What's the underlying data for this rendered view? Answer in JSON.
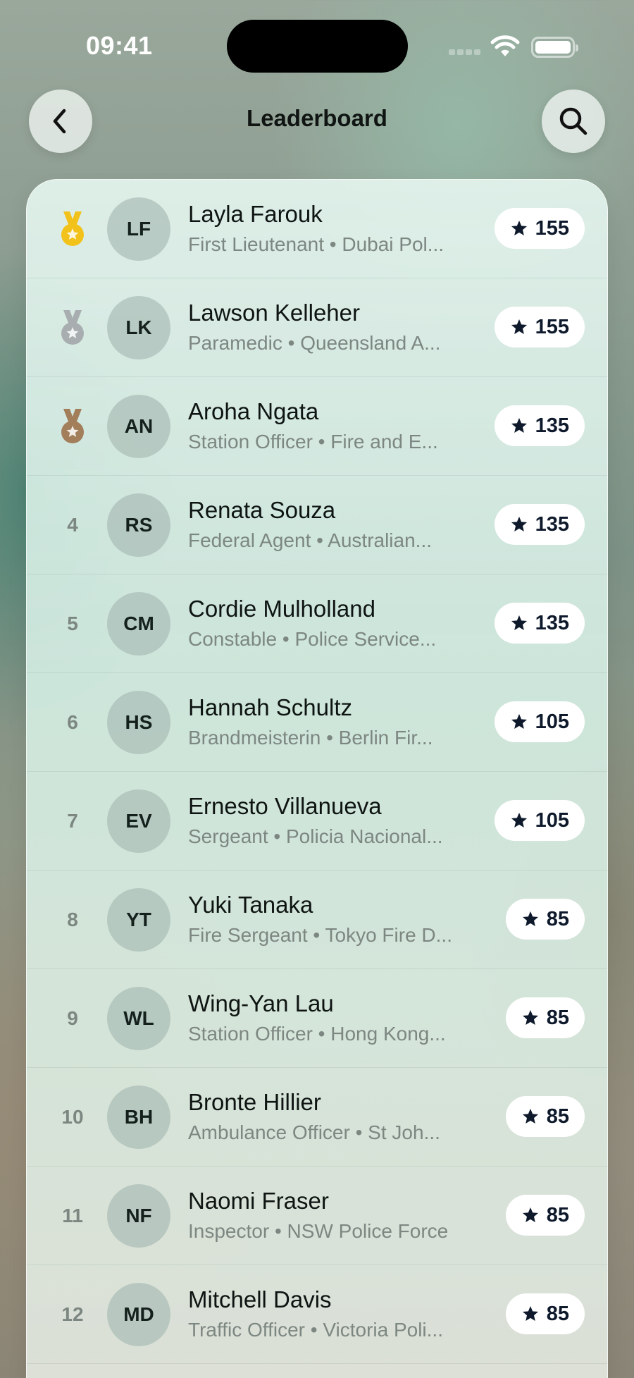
{
  "status_bar": {
    "time": "09:41"
  },
  "header": {
    "title": "Leaderboard",
    "back_icon": "chevron-left-icon",
    "search_icon": "search-icon"
  },
  "colors": {
    "gold": "#F2C21B",
    "silver": "#A8AEB0",
    "bronze": "#A37E5A",
    "score_text": "#0E1A2C"
  },
  "entries": [
    {
      "rank": "1",
      "medal": "gold",
      "initials": "LF",
      "name": "Layla Farouk",
      "subtitle": "First Lieutenant • Dubai Pol...",
      "score": "155"
    },
    {
      "rank": "2",
      "medal": "silver",
      "initials": "LK",
      "name": "Lawson Kelleher",
      "subtitle": "Paramedic • Queensland A...",
      "score": "155"
    },
    {
      "rank": "3",
      "medal": "bronze",
      "initials": "AN",
      "name": "Aroha Ngata",
      "subtitle": "Station Officer • Fire and E...",
      "score": "135"
    },
    {
      "rank": "4",
      "medal": "",
      "initials": "RS",
      "name": "Renata Souza",
      "subtitle": "Federal Agent • Australian...",
      "score": "135"
    },
    {
      "rank": "5",
      "medal": "",
      "initials": "CM",
      "name": "Cordie Mulholland",
      "subtitle": "Constable • Police Service...",
      "score": "135"
    },
    {
      "rank": "6",
      "medal": "",
      "initials": "HS",
      "name": "Hannah Schultz",
      "subtitle": "Brandmeisterin • Berlin Fir...",
      "score": "105"
    },
    {
      "rank": "7",
      "medal": "",
      "initials": "EV",
      "name": "Ernesto Villanueva",
      "subtitle": "Sergeant • Policia Nacional...",
      "score": "105"
    },
    {
      "rank": "8",
      "medal": "",
      "initials": "YT",
      "name": "Yuki Tanaka",
      "subtitle": "Fire Sergeant • Tokyo Fire D...",
      "score": "85"
    },
    {
      "rank": "9",
      "medal": "",
      "initials": "WL",
      "name": "Wing-Yan Lau",
      "subtitle": "Station Officer • Hong Kong...",
      "score": "85"
    },
    {
      "rank": "10",
      "medal": "",
      "initials": "BH",
      "name": "Bronte Hillier",
      "subtitle": "Ambulance Officer • St Joh...",
      "score": "85"
    },
    {
      "rank": "11",
      "medal": "",
      "initials": "NF",
      "name": "Naomi Fraser",
      "subtitle": "Inspector • NSW Police Force",
      "score": "85"
    },
    {
      "rank": "12",
      "medal": "",
      "initials": "MD",
      "name": "Mitchell Davis",
      "subtitle": "Traffic Officer • Victoria Poli...",
      "score": "85"
    }
  ]
}
